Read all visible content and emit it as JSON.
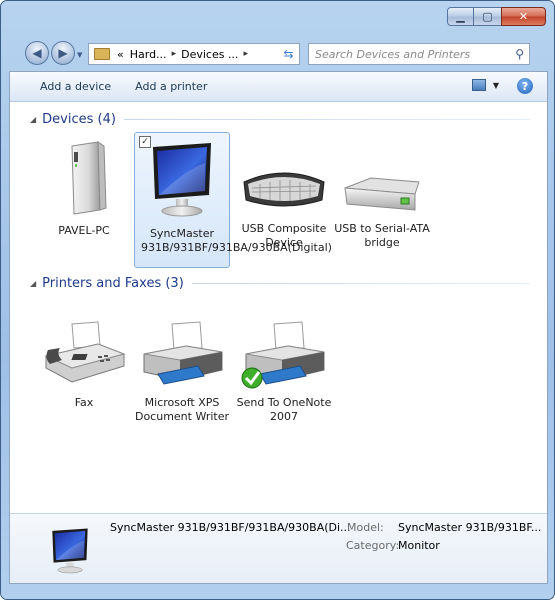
{
  "address": {
    "crumbs": [
      "«",
      "Hard...",
      "Devices ..."
    ]
  },
  "search": {
    "placeholder": "Search Devices and Printers"
  },
  "toolbar": {
    "add_device": "Add a device",
    "add_printer": "Add a printer"
  },
  "devices_group": {
    "title": "Devices (4)",
    "items": [
      {
        "label": "PAVEL-PC",
        "icon": "computer-tower-icon"
      },
      {
        "label": "SyncMaster 931B/931BF/931BA/930BA(Digital)",
        "icon": "monitor-icon",
        "selected": true
      },
      {
        "label": "USB Composite Device",
        "icon": "keyboard-icon"
      },
      {
        "label": "USB to Serial-ATA bridge",
        "icon": "hard-drive-icon"
      }
    ]
  },
  "printers_group": {
    "title": "Printers and Faxes (3)",
    "items": [
      {
        "label": "Fax",
        "icon": "fax-icon"
      },
      {
        "label": "Microsoft XPS Document Writer",
        "icon": "printer-icon"
      },
      {
        "label": "Send To OneNote 2007",
        "icon": "printer-default-icon",
        "default": true
      }
    ]
  },
  "details": {
    "name": "SyncMaster 931B/931BF/931BA/930BA(Di...",
    "model_key": "Model:",
    "model_value": "SyncMaster 931B/931BF...",
    "category_key": "Category:",
    "category_value": "Monitor"
  }
}
